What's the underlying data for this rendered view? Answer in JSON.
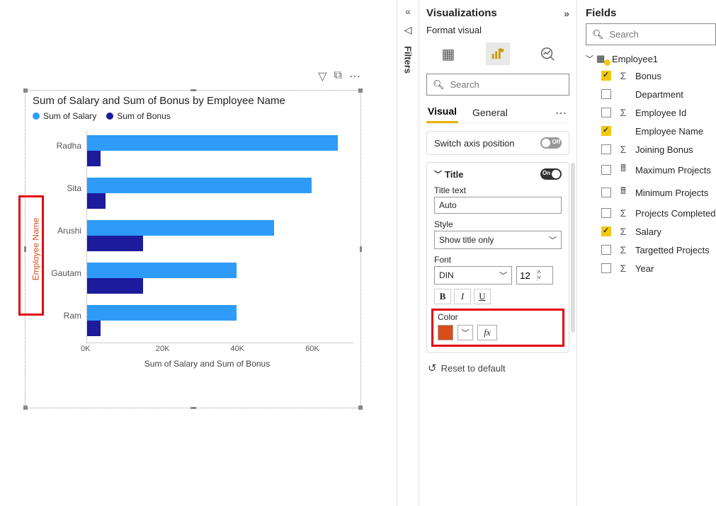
{
  "chart_data": {
    "type": "bar",
    "title": "Sum of Salary and Sum of Bonus by Employee Name",
    "ylabel": "Employee Name",
    "xlabel": "Sum of Salary and Sum of Bonus",
    "categories": [
      "Radha",
      "Sita",
      "Arushi",
      "Gautam",
      "Ram"
    ],
    "series": [
      {
        "name": "Sum of Salary",
        "color": "#2E9BF8",
        "values": [
          67000,
          60000,
          50000,
          40000,
          40000
        ]
      },
      {
        "name": "Sum of Bonus",
        "color": "#1B1B9C",
        "values": [
          3500,
          5000,
          15000,
          15000,
          3500
        ]
      }
    ],
    "xlim": [
      0,
      70000
    ],
    "xticks_labels": [
      "0K",
      "20K",
      "40K",
      "60K"
    ]
  },
  "filters_label": "Filters",
  "viz": {
    "title": "Visualizations",
    "subhead": "Format visual",
    "search_placeholder": "Search",
    "tabs": {
      "visual": "Visual",
      "general": "General"
    },
    "switch_axis": {
      "label": "Switch axis position",
      "state": "Off"
    },
    "title_section": {
      "header": "Title",
      "title_text_label": "Title text",
      "title_text_value": "Auto",
      "style_label": "Style",
      "style_value": "Show title only",
      "font_label": "Font",
      "font_family": "DIN",
      "font_size": "12",
      "color_label": "Color",
      "color_value": "#d84d1a",
      "fx_label": "fx",
      "toggle_state": "On"
    },
    "reset": "Reset to default"
  },
  "fields": {
    "title": "Fields",
    "search_placeholder": "Search",
    "table": "Employee1",
    "items": [
      {
        "label": "Bonus",
        "checked": true,
        "icon": "sigma"
      },
      {
        "label": "Department",
        "checked": false,
        "icon": ""
      },
      {
        "label": "Employee Id",
        "checked": false,
        "icon": "sigma"
      },
      {
        "label": "Employee Name",
        "checked": true,
        "icon": ""
      },
      {
        "label": "Joining Bonus",
        "checked": false,
        "icon": "sigma"
      },
      {
        "label": "Maximum Projects",
        "checked": false,
        "icon": "calc"
      },
      {
        "label": "Minimum Projects",
        "checked": false,
        "icon": "calc"
      },
      {
        "label": "Projects Completed",
        "checked": false,
        "icon": "sigma"
      },
      {
        "label": "Salary",
        "checked": true,
        "icon": "sigma"
      },
      {
        "label": "Targetted Projects",
        "checked": false,
        "icon": "sigma"
      },
      {
        "label": "Year",
        "checked": false,
        "icon": "sigma"
      }
    ]
  }
}
